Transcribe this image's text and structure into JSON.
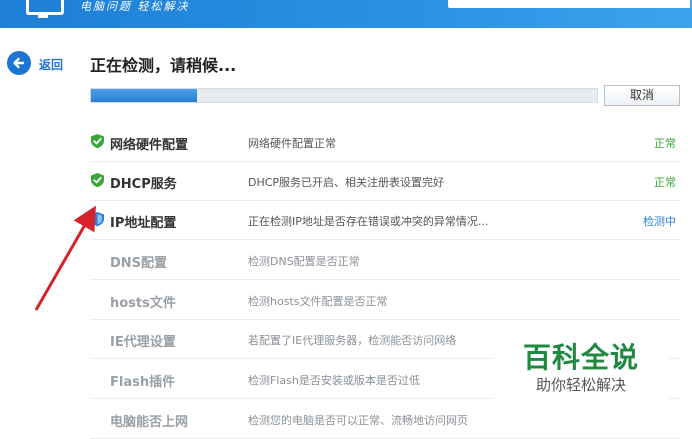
{
  "header": {
    "slogan": "电脑问题 轻松解决"
  },
  "nav": {
    "back_label": "返回"
  },
  "status": {
    "title": "正在检测，请稍候...",
    "progress_percent": 21
  },
  "buttons": {
    "cancel_label": "取消"
  },
  "items": [
    {
      "name": "网络硬件配置",
      "desc": "网络硬件配置正常",
      "state": "正常",
      "status": "ok"
    },
    {
      "name": "DHCP服务",
      "desc": "DHCP服务已开启、相关注册表设置完好",
      "state": "正常",
      "status": "ok"
    },
    {
      "name": "IP地址配置",
      "desc": "正在检测IP地址是否存在错误或冲突的异常情况...",
      "state": "检测中",
      "status": "checking"
    },
    {
      "name": "DNS配置",
      "desc": "检测DNS配置是否正常",
      "state": "",
      "status": "pending"
    },
    {
      "name": "hosts文件",
      "desc": "检测hosts文件配置是否正常",
      "state": "",
      "status": "pending"
    },
    {
      "name": "IE代理设置",
      "desc": "若配置了IE代理服务器，检测能否访问网络",
      "state": "",
      "status": "pending"
    },
    {
      "name": "Flash插件",
      "desc": "检测Flash是否安装或版本是否过低",
      "state": "",
      "status": "pending"
    },
    {
      "name": "电脑能否上网",
      "desc": "检测您的电脑是否可以正常、流畅地访问网页",
      "state": "",
      "status": "pending"
    }
  ],
  "colors": {
    "ok": "#3aa63a",
    "checking": "#2b7fd4",
    "accent": "#1e74d3"
  },
  "watermark": {
    "title": "百科全说",
    "subtitle": "助你轻松解决"
  }
}
